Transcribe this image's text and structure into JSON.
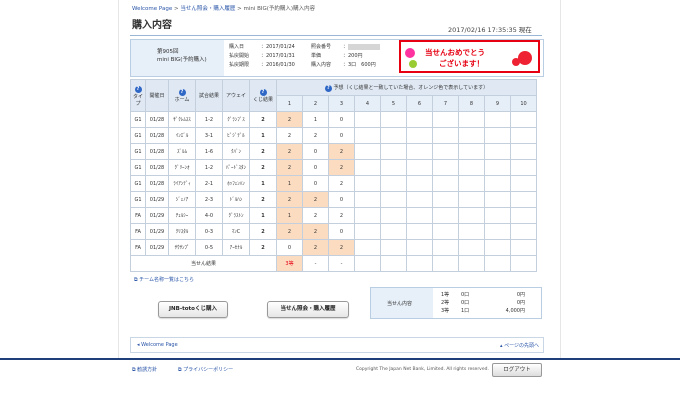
{
  "breadcrumb": {
    "home": "Welcome Page",
    "sep": " > ",
    "item1": "当せん照会・購入履歴",
    "item2": "mini BIG(予約購入)購入内容"
  },
  "page_title": "購入内容",
  "datetime": "2017/02/16 17:35:35 現在",
  "product": {
    "line1": "第905回",
    "line2": "mini BIG(予約購入)"
  },
  "info": {
    "purchase_date_label": "購入日",
    "purchase_date": "：2017/01/24",
    "pay_start_label": "払戻開始",
    "pay_start": "：2017/01/31",
    "pay_end_label": "払戻期限",
    "pay_end": "：2016/01/30",
    "ref_label": "照会番号",
    "ref_sep": "：",
    "price_label": "単価",
    "price": "：200円",
    "content_label": "購入内容",
    "content": "：3口　600円"
  },
  "banner": {
    "line1": "当せんおめでとう",
    "line2": "ございます！"
  },
  "table": {
    "headers": {
      "type": "タイプ",
      "date": "開催日",
      "home": "ホーム",
      "result": "試合結果",
      "away": "アウェイ",
      "lot": "くじ結果",
      "prediction": "予想（くじ結果と一致していた場合、オレンジ色で表示しています）"
    },
    "q": "?",
    "col_numbers": [
      "1",
      "2",
      "3",
      "4",
      "5",
      "6",
      "7",
      "8",
      "9",
      "10"
    ],
    "rows": [
      {
        "type": "G1",
        "date": "01/28",
        "home": "ｻﾞｸﾚﾑｽｽ",
        "result": "1-2",
        "away": "ｸﾞﾗﾝﾌﾞｽ",
        "lot": "2",
        "p": [
          "2",
          "1",
          "0"
        ],
        "hl": [
          true,
          false,
          false
        ]
      },
      {
        "type": "G1",
        "date": "01/28",
        "home": "ｲﾝｴﾞﾙ",
        "result": "3-1",
        "away": "ﾋﾞｼﾞﾃﾞﾙ",
        "lot": "1",
        "p": [
          "2",
          "2",
          "0"
        ],
        "hl": [
          false,
          false,
          false
        ]
      },
      {
        "type": "G1",
        "date": "01/28",
        "home": "ｽﾞﾙﾑ",
        "result": "1-6",
        "away": "ｸﾊﾞﾝ",
        "lot": "2",
        "p": [
          "2",
          "0",
          "2"
        ],
        "hl": [
          true,
          false,
          true
        ]
      },
      {
        "type": "G1",
        "date": "01/28",
        "home": "ｸﾞﾘｰﾝｵ",
        "result": "1-2",
        "away": "ﾊﾟｰﾄﾞｽﾀﾝ",
        "lot": "2",
        "p": [
          "2",
          "0",
          "2"
        ],
        "hl": [
          true,
          false,
          true
        ]
      },
      {
        "type": "G1",
        "date": "01/28",
        "home": "ﾗｲｱﾝﾃﾞｨ",
        "result": "2-1",
        "away": "ﾎｯﾌｪﾝﾊﾝ",
        "lot": "1",
        "p": [
          "1",
          "0",
          "2"
        ],
        "hl": [
          true,
          false,
          false
        ]
      },
      {
        "type": "G1",
        "date": "01/29",
        "home": "ｼﾞｪﾉｱ",
        "result": "2-3",
        "away": "ﾄﾞﾙﾊﾝ",
        "lot": "2",
        "p": [
          "2",
          "2",
          "0"
        ],
        "hl": [
          true,
          true,
          false
        ]
      },
      {
        "type": "FA",
        "date": "01/29",
        "home": "ﾁｪﾙｼｰ",
        "result": "4-0",
        "away": "ｸﾞﾗｽﾄﾝ",
        "lot": "1",
        "p": [
          "1",
          "2",
          "2"
        ],
        "hl": [
          true,
          false,
          false
        ]
      },
      {
        "type": "FA",
        "date": "01/29",
        "home": "ｸﾘｽﾀﾙ",
        "result": "0-3",
        "away": "ﾏﾝC",
        "lot": "2",
        "p": [
          "2",
          "2",
          "0"
        ],
        "hl": [
          true,
          true,
          false
        ]
      },
      {
        "type": "FA",
        "date": "01/29",
        "home": "ｻｳｻﾝﾌﾟ",
        "result": "0-5",
        "away": "ｱｰｾﾅﾙ",
        "lot": "2",
        "p": [
          "0",
          "2",
          "2"
        ],
        "hl": [
          false,
          true,
          true
        ]
      }
    ],
    "result_label": "当せん結果",
    "result_values": [
      "3等",
      "-",
      "-"
    ]
  },
  "team_link": "チーム名称一覧はこちら",
  "buttons": {
    "buy": "JNB-totoくじ購入",
    "history": "当せん照会・購入履歴"
  },
  "summary": {
    "label": "当せん内容",
    "rows": [
      {
        "rank": "1等",
        "count": "0口",
        "amount": "0円"
      },
      {
        "rank": "2等",
        "count": "0口",
        "amount": "0円"
      },
      {
        "rank": "3等",
        "count": "1口",
        "amount": "4,000円"
      }
    ]
  },
  "nav": {
    "welcome": "Welcome Page",
    "top": "ページの先頭へ"
  },
  "footer": {
    "link1": "勧誘方針",
    "link2": "プライバシーポリシー",
    "copyright": "Copyright The Japan Net Bank, Limited. All rights reserved.",
    "logout": "ログアウト"
  }
}
